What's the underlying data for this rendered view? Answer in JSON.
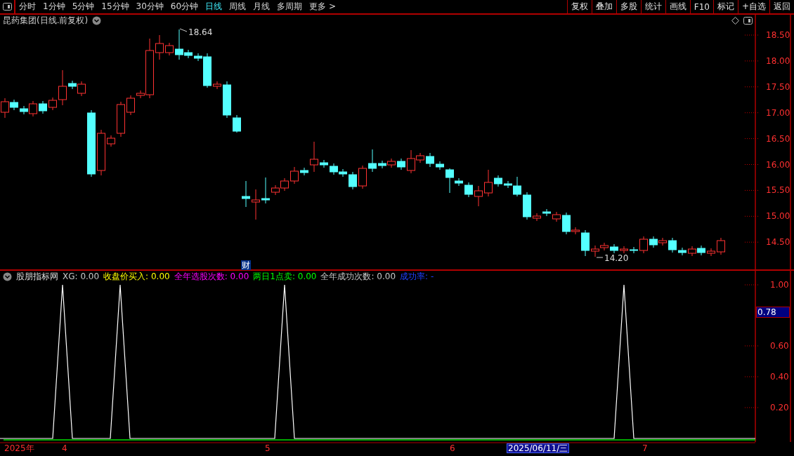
{
  "toolbar": {
    "periods": [
      {
        "label": "分时",
        "selected": false
      },
      {
        "label": "1分钟",
        "selected": false
      },
      {
        "label": "5分钟",
        "selected": false
      },
      {
        "label": "15分钟",
        "selected": false
      },
      {
        "label": "30分钟",
        "selected": false
      },
      {
        "label": "60分钟",
        "selected": false
      },
      {
        "label": "日线",
        "selected": true
      },
      {
        "label": "周线",
        "selected": false
      },
      {
        "label": "月线",
        "selected": false
      },
      {
        "label": "多周期",
        "selected": false
      }
    ],
    "more": "更多 >",
    "actions": [
      "复权",
      "叠加",
      "多股",
      "统计",
      "画线",
      "F10",
      "标记",
      "+自选",
      "返回"
    ]
  },
  "price_chart": {
    "title": "昆药集团(日线.前复权)",
    "high_label": "18.64",
    "low_label": "14.20",
    "event_marker": "财",
    "ticks": [
      "18.50",
      "18.00",
      "17.50",
      "17.00",
      "16.50",
      "16.00",
      "15.50",
      "15.00",
      "14.50"
    ]
  },
  "indicator": {
    "name": "股朋指标网",
    "fields": [
      {
        "label": "XG: 0.00",
        "color": "#c8c8c8"
      },
      {
        "label": "收盘价买入: 0.00",
        "color": "#ffff00"
      },
      {
        "label": "全年选股次数: 0.00",
        "color": "#ff00ff"
      },
      {
        "label": "两日1点卖: 0.00",
        "color": "#00ff00"
      },
      {
        "label": "全年成功次数: 0.00",
        "color": "#c8c8c8"
      },
      {
        "label": "成功率: -",
        "color": "#2040ff"
      }
    ],
    "ticks": [
      "1.00",
      "0.60",
      "0.40",
      "0.20"
    ],
    "current_value": "0.78"
  },
  "time_axis": {
    "year": "2025年",
    "months": [
      "4",
      "5",
      "6",
      "7"
    ],
    "cursor_date": "2025/06/11/三"
  }
}
